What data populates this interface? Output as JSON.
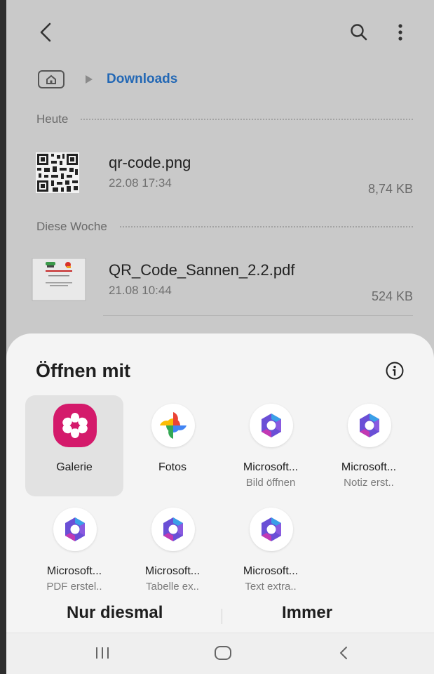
{
  "header": {
    "back_icon": "chevron-left-icon",
    "search_icon": "search-icon",
    "more_icon": "more-vertical-icon"
  },
  "breadcrumb": {
    "home_icon": "home-icon",
    "current": "Downloads",
    "accent": "#2368b5"
  },
  "sections": [
    {
      "label": "Heute",
      "files": [
        {
          "name": "qr-code.png",
          "date": "22.08 17:34",
          "size": "8,74 KB",
          "thumb": "qr-code-thumbnail"
        }
      ]
    },
    {
      "label": "Diese Woche",
      "files": [
        {
          "name": "QR_Code_Sannen_2.2.pdf",
          "date": "21.08 10:44",
          "size": "524 KB",
          "thumb": "pdf-thumbnail"
        }
      ]
    }
  ],
  "sheet": {
    "title": "Öffnen mit",
    "info_icon": "info-icon",
    "apps": [
      {
        "name": "Galerie",
        "sub": "",
        "icon": "gallery-icon",
        "selected": true
      },
      {
        "name": "Fotos",
        "sub": "",
        "icon": "google-photos-icon"
      },
      {
        "name": "Microsoft...",
        "sub": "Bild öffnen",
        "icon": "microsoft-365-icon"
      },
      {
        "name": "Microsoft...",
        "sub": "Notiz erst..",
        "icon": "microsoft-365-icon"
      },
      {
        "name": "Microsoft...",
        "sub": "PDF erstel..",
        "icon": "microsoft-365-icon"
      },
      {
        "name": "Microsoft...",
        "sub": "Tabelle ex..",
        "icon": "microsoft-365-icon"
      },
      {
        "name": "Microsoft...",
        "sub": "Text extra..",
        "icon": "microsoft-365-icon"
      }
    ],
    "actions": {
      "once": "Nur diesmal",
      "always": "Immer"
    }
  },
  "navbar": {
    "recents_icon": "recent-apps-icon",
    "home_icon": "home-circle-icon",
    "back_icon": "back-icon"
  },
  "colors": {
    "gallery": "#d41a6b",
    "sheet_bg": "#f4f4f4",
    "dim_bg": "#c9c9c9"
  }
}
